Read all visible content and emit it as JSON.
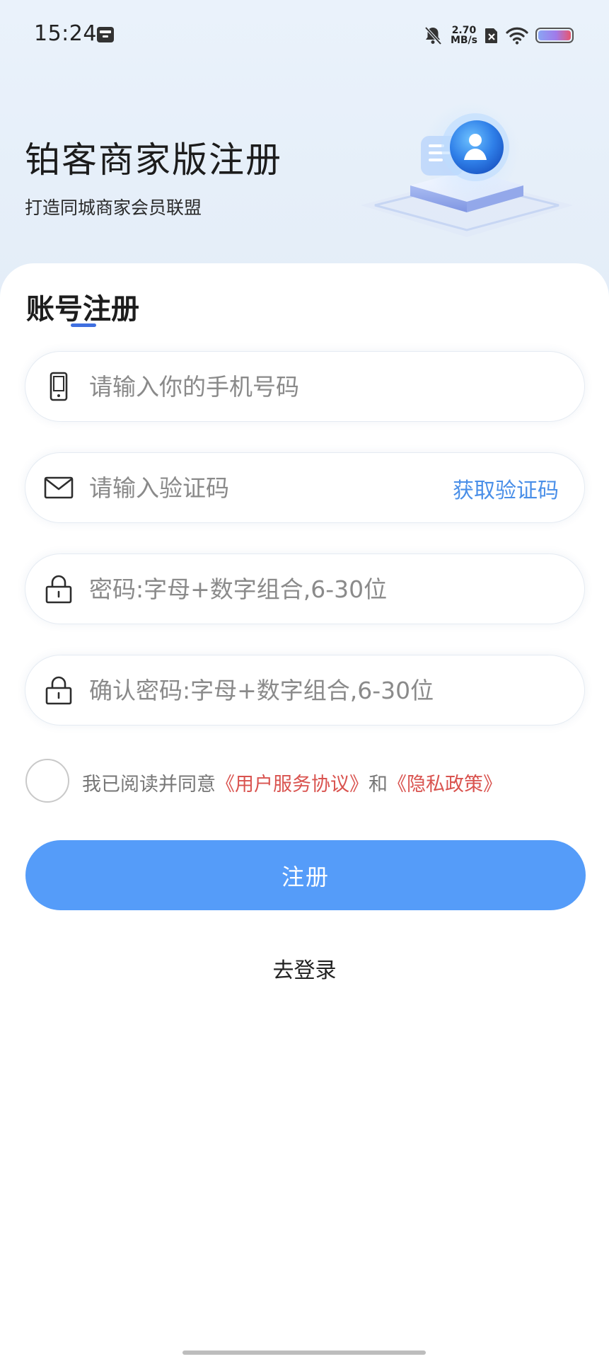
{
  "status_bar": {
    "time": "15:24",
    "net_speed_value": "2.70",
    "net_speed_unit": "MB/s",
    "battery_color": "#8f7fe8"
  },
  "header": {
    "title": "铂客商家版注册",
    "subtitle": "打造同城商家会员联盟"
  },
  "form": {
    "section_title": "账号注册",
    "phone": {
      "value": "",
      "placeholder": "请输入你的手机号码",
      "icon": "phone-icon"
    },
    "code": {
      "value": "",
      "placeholder": "请输入验证码",
      "icon": "mail-icon",
      "get_code_label": "获取验证码"
    },
    "password": {
      "value": "",
      "placeholder": "密码:字母+数字组合,6-30位",
      "icon": "lock-icon"
    },
    "confirm_password": {
      "value": "",
      "placeholder": "确认密码:字母+数字组合,6-30位",
      "icon": "lock-icon"
    },
    "agreement": {
      "checked": false,
      "prefix": "我已阅读并同意",
      "terms": "《用户服务协议》",
      "and": "和",
      "privacy": "《隐私政策》"
    },
    "submit_label": "注册",
    "login_link": "去登录"
  },
  "colors": {
    "accent": "#559cf9",
    "link_blue": "#4a8fe8",
    "link_red": "#d9534f",
    "underline": "#3f6fe0"
  }
}
